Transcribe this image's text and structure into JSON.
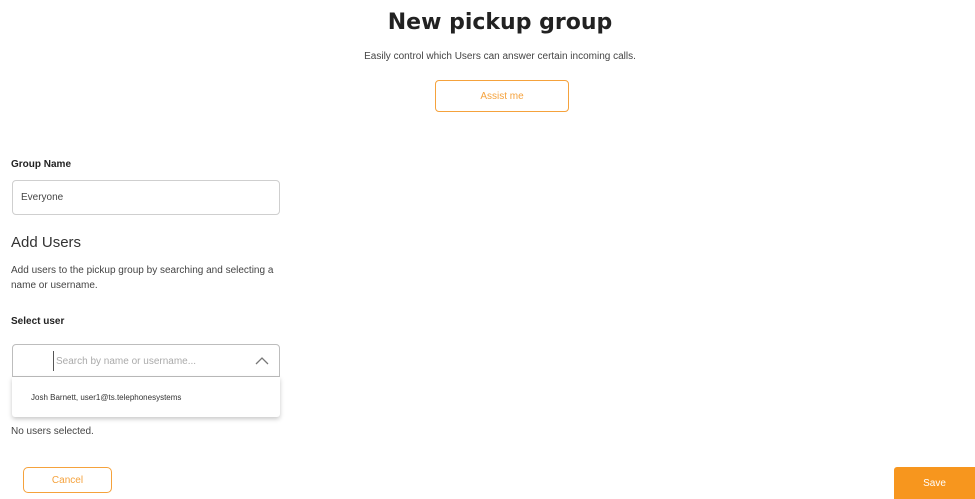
{
  "header": {
    "title": "New pickup group",
    "subtitle": "Easily control which Users can answer certain incoming calls.",
    "assist_label": "Assist me"
  },
  "group_name": {
    "label": "Group Name",
    "value": "Everyone"
  },
  "add_users": {
    "heading": "Add Users",
    "description": "Add users to the pickup group by searching and selecting a name or username."
  },
  "select_user": {
    "label": "Select user",
    "placeholder": "Search by name or username...",
    "value": "",
    "options": [
      {
        "label": "Josh Barnett, user1@ts.telephonesystems"
      }
    ]
  },
  "selection_status": "No users selected.",
  "footer": {
    "cancel_label": "Cancel",
    "save_label": "Save"
  },
  "colors": {
    "accent": "#f7961e",
    "accent_border": "#f5a23c"
  }
}
